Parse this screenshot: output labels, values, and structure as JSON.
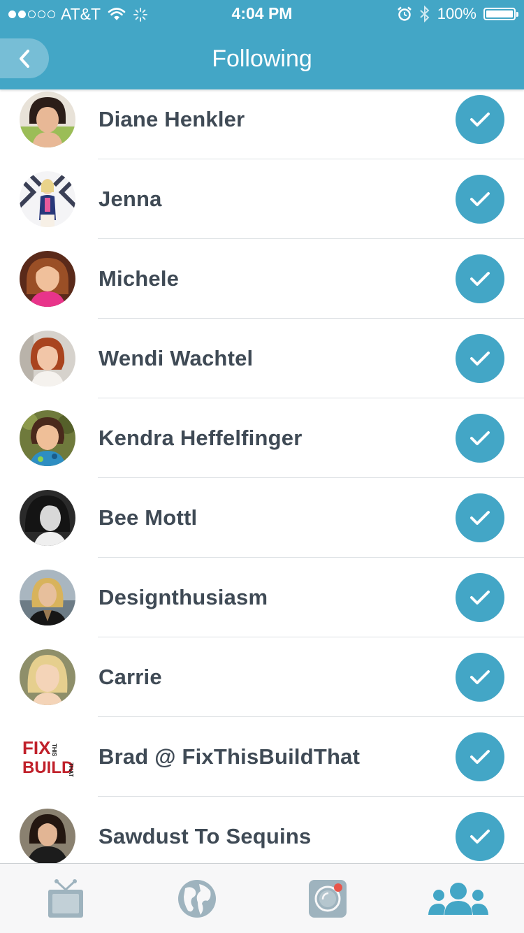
{
  "status_bar": {
    "carrier": "AT&T",
    "time": "4:04 PM",
    "battery": "100%"
  },
  "nav": {
    "title": "Following",
    "back_icon": "chevron-left-icon"
  },
  "following": [
    {
      "name": "Diane Henkler",
      "avatar": "avatar-photo",
      "following": true
    },
    {
      "name": "Jenna",
      "avatar": "avatar-photo",
      "following": true
    },
    {
      "name": "Michele",
      "avatar": "avatar-photo",
      "following": true
    },
    {
      "name": "Wendi Wachtel",
      "avatar": "avatar-photo",
      "following": true
    },
    {
      "name": "Kendra Heffelfinger",
      "avatar": "avatar-photo",
      "following": true
    },
    {
      "name": "Bee Mottl",
      "avatar": "avatar-photo",
      "following": true
    },
    {
      "name": "Designthusiasm",
      "avatar": "avatar-photo",
      "following": true
    },
    {
      "name": "Carrie",
      "avatar": "avatar-photo",
      "following": true
    },
    {
      "name": "Brad @ FixThisBuildThat",
      "avatar": "fix-this-build-that-logo",
      "following": true
    },
    {
      "name": "Sawdust To Sequins",
      "avatar": "avatar-photo",
      "following": true
    }
  ],
  "brad_logo": {
    "line1": "FIX",
    "line2": "BUILD",
    "small1": "THIS",
    "small2": "THAT"
  },
  "tabs": [
    {
      "icon": "tv-icon",
      "active": false
    },
    {
      "icon": "globe-icon",
      "active": false
    },
    {
      "icon": "camera-icon",
      "active": false
    },
    {
      "icon": "people-icon",
      "active": true
    }
  ],
  "colors": {
    "accent": "#43a6c6",
    "tab_inactive": "#9eb3be",
    "text": "#3f4a55",
    "notification": "#e8554a"
  }
}
